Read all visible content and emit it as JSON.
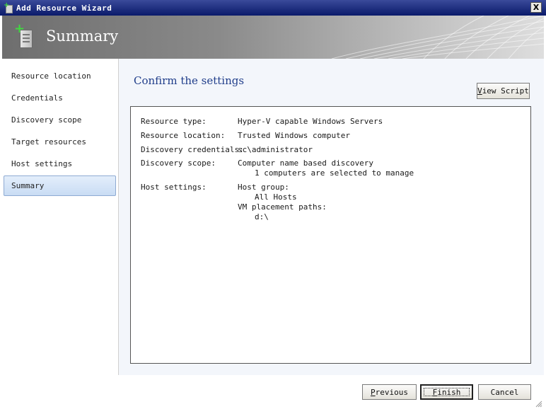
{
  "window": {
    "title": "Add Resource Wizard",
    "close_glyph": "X"
  },
  "banner": {
    "title": "Summary",
    "icon": "server-add-icon"
  },
  "nav": {
    "items": [
      {
        "label": "Resource location"
      },
      {
        "label": "Credentials"
      },
      {
        "label": "Discovery scope"
      },
      {
        "label": "Target resources"
      },
      {
        "label": "Host settings"
      },
      {
        "label": "Summary"
      }
    ],
    "active": "Summary"
  },
  "content": {
    "heading": "Confirm the settings",
    "view_script": {
      "underline": "V",
      "rest": "iew Script"
    }
  },
  "summary": {
    "resource_type": {
      "label": "Resource type:",
      "value": "Hyper-V capable Windows Servers"
    },
    "resource_location": {
      "label": "Resource location:",
      "value": "Trusted Windows computer"
    },
    "discovery_credentials": {
      "label": "Discovery credentials:",
      "value": "sc\\administrator"
    },
    "discovery_scope": {
      "label": "Discovery scope:",
      "value": "Computer name based discovery",
      "detail": "1 computers are selected to manage"
    },
    "host_settings": {
      "label": "Host settings:",
      "host_group_label": "Host group:",
      "host_group_value": "All Hosts",
      "placement_label": "VM placement paths:",
      "placement_value": "d:\\"
    }
  },
  "footer": {
    "previous": {
      "underline": "P",
      "rest": "revious"
    },
    "finish": {
      "underline": "F",
      "rest": "inish"
    },
    "cancel": "Cancel"
  },
  "colors": {
    "title_bar": "#0a1a6a",
    "heading": "#1f3d8a",
    "active_nav": "#c9dcf4",
    "content_bg": "#f3f6fb"
  }
}
